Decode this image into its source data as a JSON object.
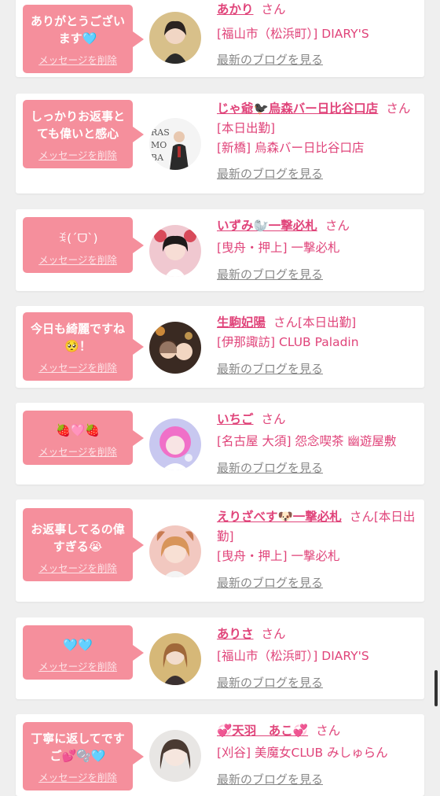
{
  "common": {
    "delete_label": "メッセージを削除",
    "san": "さん",
    "blog_link": "最新のブログを見る"
  },
  "colors": {
    "page_bg": "#efefef",
    "bubble": "#f58f9c",
    "accent_text": "#e0447a",
    "link_gray": "#888888"
  },
  "messages": [
    {
      "message": "ありがとうございます🩵",
      "name": "あかり",
      "status": "",
      "shop": "[福山市（松浜町）] DIARY'S"
    },
    {
      "message": "しっかりお返事とても偉いと感心",
      "name": "じゃ爺🐦‍⬛烏森バー日比谷口店",
      "status": "[本日出勤]",
      "shop": "[新橋] 烏森バー日比谷口店"
    },
    {
      "message": "ꉂ(ˊᗜˋ)",
      "name": "いずみ🦭一撃必札",
      "status": "",
      "shop": "[曳舟・押上] 一撃必札"
    },
    {
      "message": "今日も綺麗ですね🥺！",
      "name": "生駒妃陽",
      "status": "[本日出勤]",
      "shop": "[伊那諏訪] CLUB Paladin"
    },
    {
      "message": "🍓🩷🍓",
      "name": "いちご",
      "status": "",
      "shop": "[名古屋 大須] 怨念喫茶 幽遊屋敷"
    },
    {
      "message": "お返事してるの偉すぎる😭",
      "name": "えりざべす🐶一撃必札",
      "status": "[本日出勤]",
      "shop": "[曳舟・押上] 一撃必札"
    },
    {
      "message": "🩵🩵",
      "name": "ありさ",
      "status": "",
      "shop": "[福山市（松浜町）] DIARY'S"
    },
    {
      "message": "丁寧に返してですご💕🫧🩵",
      "name": "💞天羽　あこ💞",
      "status": "",
      "shop": "[刈谷] 美魔女CLUB みしゅらん"
    }
  ]
}
